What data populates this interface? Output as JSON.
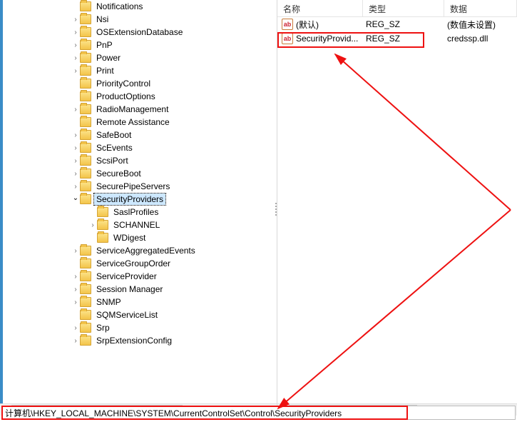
{
  "tree": {
    "indent_base": 96,
    "child_indent": 24,
    "items": [
      {
        "label": "Notifications",
        "chev": ""
      },
      {
        "label": "Nsi",
        "chev": ">"
      },
      {
        "label": "OSExtensionDatabase",
        "chev": ">"
      },
      {
        "label": "PnP",
        "chev": ">"
      },
      {
        "label": "Power",
        "chev": ">"
      },
      {
        "label": "Print",
        "chev": ">"
      },
      {
        "label": "PriorityControl",
        "chev": ""
      },
      {
        "label": "ProductOptions",
        "chev": ""
      },
      {
        "label": "RadioManagement",
        "chev": ">"
      },
      {
        "label": "Remote Assistance",
        "chev": ""
      },
      {
        "label": "SafeBoot",
        "chev": ">"
      },
      {
        "label": "ScEvents",
        "chev": ">"
      },
      {
        "label": "ScsiPort",
        "chev": ">"
      },
      {
        "label": "SecureBoot",
        "chev": ">"
      },
      {
        "label": "SecurePipeServers",
        "chev": ">"
      },
      {
        "label": "SecurityProviders",
        "chev": "v",
        "selected": true
      },
      {
        "label": "SaslProfiles",
        "chev": "",
        "child": true
      },
      {
        "label": "SCHANNEL",
        "chev": ">",
        "child": true
      },
      {
        "label": "WDigest",
        "chev": "",
        "child": true
      },
      {
        "label": "ServiceAggregatedEvents",
        "chev": ">"
      },
      {
        "label": "ServiceGroupOrder",
        "chev": ""
      },
      {
        "label": "ServiceProvider",
        "chev": ">"
      },
      {
        "label": "Session Manager",
        "chev": ">"
      },
      {
        "label": "SNMP",
        "chev": ">"
      },
      {
        "label": "SQMServiceList",
        "chev": ""
      },
      {
        "label": "Srp",
        "chev": ">"
      },
      {
        "label": "SrpExtensionConfig",
        "chev": ">"
      }
    ]
  },
  "columns": {
    "name": "名称",
    "type": "类型",
    "data": "数据"
  },
  "values": [
    {
      "icon": "ab",
      "name": "(默认)",
      "type": "REG_SZ",
      "data": "(数值未设置)"
    },
    {
      "icon": "ab",
      "name": "SecurityProvid...",
      "type": "REG_SZ",
      "data": "credssp.dll"
    }
  ],
  "path": "计算机\\HKEY_LOCAL_MACHINE\\SYSTEM\\CurrentControlSet\\Control\\SecurityProviders"
}
